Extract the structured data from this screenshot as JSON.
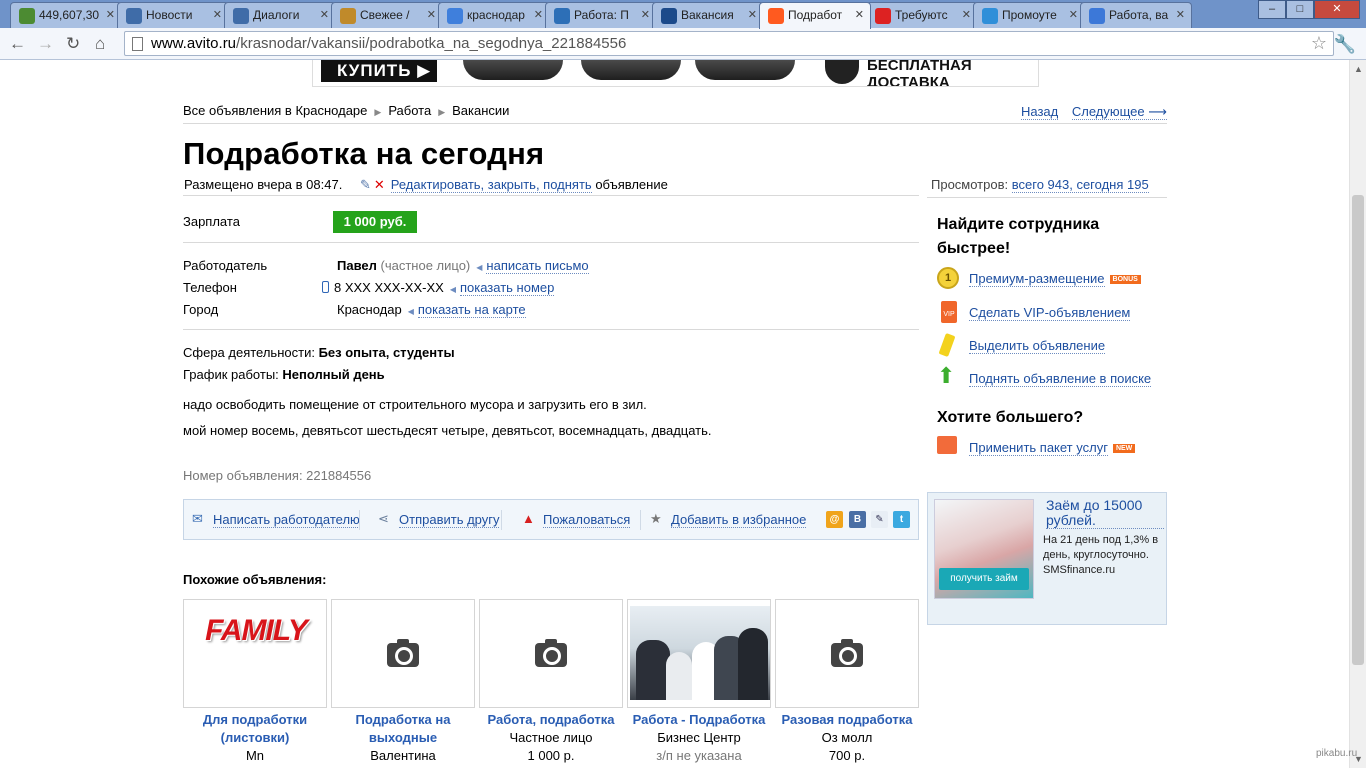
{
  "browser": {
    "tabs": [
      {
        "label": "449,607,30",
        "color": "#4c8b32"
      },
      {
        "label": "Новости",
        "color": "#3f6ca8"
      },
      {
        "label": "Диалоги",
        "color": "#3f6ca8"
      },
      {
        "label": "Свежее / ",
        "color": "#c08a2a"
      },
      {
        "label": "краснодар",
        "color": "#3f7fdc"
      },
      {
        "label": "Работа: П",
        "color": "#2d6fb7"
      },
      {
        "label": "Вакансия",
        "color": "#1c4a8a"
      },
      {
        "label": "Подработ",
        "color": "#ff5a1f"
      },
      {
        "label": "Требуютс",
        "color": "#d22"
      },
      {
        "label": "Промоуте",
        "color": "#2f8fd9"
      },
      {
        "label": "Работа, ва",
        "color": "#3c78d8"
      }
    ],
    "url_domain": "www.avito.ru",
    "url_path": "/krasnodar/vakansii/podrabotka_na_segodnya_221884556",
    "window_controls": {
      "minimize": "–",
      "maximize": "□",
      "close": "✕"
    }
  },
  "banner": {
    "buy_label": "КУПИТЬ ▶",
    "delivery_label": "БЕСПЛАТНАЯ ДОСТАВКА"
  },
  "breadcrumbs": [
    "Все объявления в Краснодаре",
    "Работа",
    "Вакансии"
  ],
  "nav": {
    "back": "Назад",
    "next": "Следующее ⟶"
  },
  "title": "Подработка на сегодня",
  "meta": {
    "posted": "Размещено вчера в 08:47.",
    "edit_link": "Редактировать, закрыть, поднять",
    "edit_suffix": "объявление",
    "views_label": "Просмотров:",
    "views_value": "всего 943, сегодня 195"
  },
  "details": {
    "salary_label": "Зарплата",
    "salary_value": "1 000 руб.",
    "employer_label": "Работодатель",
    "employer_name": "Павел",
    "employer_type": "(частное лицо)",
    "write_link": "написать письмо",
    "phone_label": "Телефон",
    "phone_value": "8 XXX XXX-XX-XX",
    "phone_link": "показать номер",
    "city_label": "Город",
    "city_value": "Краснодар",
    "map_link": "показать на карте",
    "sphere_label": "Сфера деятельности:",
    "sphere_value": "Без опыта, студенты",
    "schedule_label": "График работы:",
    "schedule_value": "Неполный день",
    "description": [
      "надо освободить помещение от строительного мусора и загрузить его в зил.",
      "мой номер восемь, девятьсот шестьдесят четыре, девятьсот, восемнадцать, двадцать."
    ],
    "ad_number": "Номер объявления: 221884556"
  },
  "actions": {
    "write": "Написать работодателю",
    "share": "Отправить другу",
    "complain": "Пожаловаться",
    "favorite": "Добавить в избранное"
  },
  "similar": {
    "heading": "Похожие объявления:",
    "items": [
      {
        "title": "Для подработки",
        "title2": "(листовки)",
        "sub": "Mn",
        "image": "family",
        "image_text": "FAMILY"
      },
      {
        "title": "Подработка на",
        "title2": "выходные",
        "sub": "Валентина",
        "image": "camera"
      },
      {
        "title": "Работа, подработка",
        "title2": "",
        "sub": "Частное лицо",
        "sub2": "1 000 р.",
        "image": "camera"
      },
      {
        "title": "Работа - Подработка",
        "title2": "",
        "sub": "Бизнес Центр",
        "sub2": "з/п не указана",
        "image": "photo"
      },
      {
        "title": "Разовая подработка",
        "title2": "",
        "sub": "Оз молл",
        "sub2": "700 р.",
        "image": "camera"
      }
    ]
  },
  "sidebar": {
    "promo_heading": "Найдите сотрудника быстрее!",
    "promo_items": [
      {
        "label": "Премиум-размещение",
        "badge": "BONUS",
        "icon": "coin-icon"
      },
      {
        "label": "Сделать VIP-объявлением",
        "icon": "vip-icon"
      },
      {
        "label": "Выделить объявление",
        "icon": "marker-icon"
      },
      {
        "label": "Поднять объявление в поиске",
        "icon": "up-arrow-icon"
      }
    ],
    "more_heading": "Хотите большего?",
    "package_label": "Применить пакет услуг",
    "package_badge": "NEW",
    "ad": {
      "title": "Заём до 15000 рублей.",
      "text": "На 21 день под 1,3% в день, круглосуточно. SMSfinance.ru",
      "button": "получить займ"
    }
  },
  "watermark": "pikabu.ru"
}
